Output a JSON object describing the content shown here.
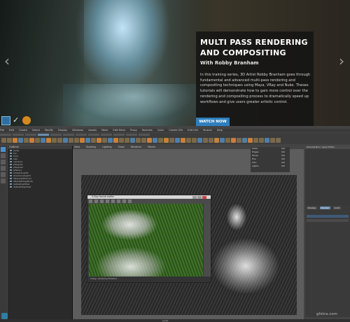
{
  "hero": {
    "title": "MULTI PASS RENDERING AND COMPOSITING",
    "author": "With Robby Branham",
    "description": "In this training series, 3D Artist Robby Branham goes through fundamental and advanced multi-pass rendering and compositing techniques using Maya, VRay and Nuke. Theses tutorials will demonstrate how to gain more control over the rendering and compositing process to dramatically speed up workflows and give users greater artistic control.",
    "cta_label": "WATCH NOW",
    "prev_arrow": "‹",
    "next_arrow": "›",
    "brand_color": "#2e7fbf"
  },
  "maya": {
    "menu_items": [
      "File",
      "Edit",
      "Create",
      "Select",
      "Modify",
      "Display",
      "Windows",
      "Assets",
      "Mesh",
      "Edit Mesh",
      "Proxy",
      "Normals",
      "Color",
      "Create UVs",
      "Edit UVs",
      "Muscle",
      "Help"
    ],
    "viewport_menu": [
      "View",
      "Shading",
      "Lighting",
      "Show",
      "Renderer",
      "Panels"
    ],
    "outliner_title": "Outliner",
    "outliner_rows": [
      "persp",
      "top",
      "front",
      "side",
      "camera1",
      "pTeapot1",
      "pTeapot2",
      "pPlane1",
      "ambientLight1",
      "directionalLight1",
      "VRayLightDome1",
      "VRaySettingsNode",
      "defaultLightSet",
      "defaultObjectSet"
    ],
    "stats": [
      {
        "key": "Verts:",
        "value": "0/0"
      },
      {
        "key": "Edges:",
        "value": "0/0"
      },
      {
        "key": "Faces:",
        "value": "0/0"
      },
      {
        "key": "Tris:",
        "value": "0/0"
      },
      {
        "key": "UVs:",
        "value": "0/0"
      },
      {
        "key": "Lights:",
        "value": "0/0"
      }
    ],
    "render_window_title": "V-Ray frame buffer",
    "render_status": "V-Ray: rendering finished",
    "channel_box_title": "Channel Box / Layer Editor",
    "layer_tabs": [
      "Display",
      "Render",
      "Anim"
    ],
    "help_line": "persp",
    "watermark": "gfxtra.com"
  }
}
